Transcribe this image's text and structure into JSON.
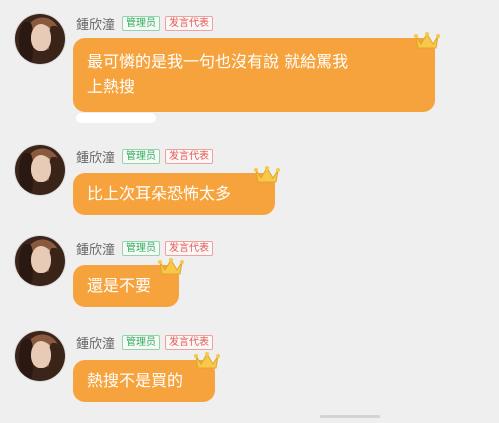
{
  "messages": [
    {
      "sender": "鍾欣潼",
      "badges": {
        "admin": "管理员",
        "speaker": "发言代表"
      },
      "text_line1": "最可憐的是我一句也沒有說 就給罵我",
      "text_line2": "上熱搜"
    },
    {
      "sender": "鍾欣潼",
      "badges": {
        "admin": "管理员",
        "speaker": "发言代表"
      },
      "text_line1": "比上次耳朵恐怖太多"
    },
    {
      "sender": "鍾欣潼",
      "badges": {
        "admin": "管理员",
        "speaker": "发言代表"
      },
      "text_line1": "還是不要"
    },
    {
      "sender": "鍾欣潼",
      "badges": {
        "admin": "管理员",
        "speaker": "发言代表"
      },
      "text_line1": "熱搜不是買的"
    }
  ],
  "colors": {
    "bubble": "#f6a33d",
    "admin_badge": "#2eaf5c",
    "speaker_badge": "#e8574f",
    "background": "#efefef"
  },
  "icons": {
    "avatar": "avatar-photo",
    "crown": "crown-icon"
  }
}
